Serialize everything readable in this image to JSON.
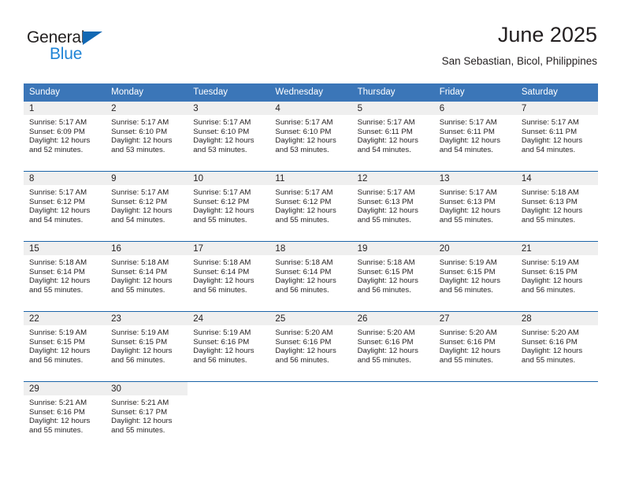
{
  "logo": {
    "primary_text": "General",
    "secondary_text": "Blue",
    "primary_color": "#221f1f",
    "accent_color": "#1268b3",
    "secondary_color": "#1f84d6"
  },
  "header": {
    "title": "June 2025",
    "subtitle": "San Sebastian, Bicol, Philippines"
  },
  "theme": {
    "header_row_bg": "#3b76b8",
    "header_row_text": "#ffffff",
    "day_number_bg": "#efefef",
    "row_divider": "#1b64a8",
    "body_text": "#231f20"
  },
  "weekdays": [
    "Sunday",
    "Monday",
    "Tuesday",
    "Wednesday",
    "Thursday",
    "Friday",
    "Saturday"
  ],
  "weeks": [
    [
      {
        "day": "1",
        "sunrise": "Sunrise: 5:17 AM",
        "sunset": "Sunset: 6:09 PM",
        "daylight_1": "Daylight: 12 hours",
        "daylight_2": "and 52 minutes."
      },
      {
        "day": "2",
        "sunrise": "Sunrise: 5:17 AM",
        "sunset": "Sunset: 6:10 PM",
        "daylight_1": "Daylight: 12 hours",
        "daylight_2": "and 53 minutes."
      },
      {
        "day": "3",
        "sunrise": "Sunrise: 5:17 AM",
        "sunset": "Sunset: 6:10 PM",
        "daylight_1": "Daylight: 12 hours",
        "daylight_2": "and 53 minutes."
      },
      {
        "day": "4",
        "sunrise": "Sunrise: 5:17 AM",
        "sunset": "Sunset: 6:10 PM",
        "daylight_1": "Daylight: 12 hours",
        "daylight_2": "and 53 minutes."
      },
      {
        "day": "5",
        "sunrise": "Sunrise: 5:17 AM",
        "sunset": "Sunset: 6:11 PM",
        "daylight_1": "Daylight: 12 hours",
        "daylight_2": "and 54 minutes."
      },
      {
        "day": "6",
        "sunrise": "Sunrise: 5:17 AM",
        "sunset": "Sunset: 6:11 PM",
        "daylight_1": "Daylight: 12 hours",
        "daylight_2": "and 54 minutes."
      },
      {
        "day": "7",
        "sunrise": "Sunrise: 5:17 AM",
        "sunset": "Sunset: 6:11 PM",
        "daylight_1": "Daylight: 12 hours",
        "daylight_2": "and 54 minutes."
      }
    ],
    [
      {
        "day": "8",
        "sunrise": "Sunrise: 5:17 AM",
        "sunset": "Sunset: 6:12 PM",
        "daylight_1": "Daylight: 12 hours",
        "daylight_2": "and 54 minutes."
      },
      {
        "day": "9",
        "sunrise": "Sunrise: 5:17 AM",
        "sunset": "Sunset: 6:12 PM",
        "daylight_1": "Daylight: 12 hours",
        "daylight_2": "and 54 minutes."
      },
      {
        "day": "10",
        "sunrise": "Sunrise: 5:17 AM",
        "sunset": "Sunset: 6:12 PM",
        "daylight_1": "Daylight: 12 hours",
        "daylight_2": "and 55 minutes."
      },
      {
        "day": "11",
        "sunrise": "Sunrise: 5:17 AM",
        "sunset": "Sunset: 6:12 PM",
        "daylight_1": "Daylight: 12 hours",
        "daylight_2": "and 55 minutes."
      },
      {
        "day": "12",
        "sunrise": "Sunrise: 5:17 AM",
        "sunset": "Sunset: 6:13 PM",
        "daylight_1": "Daylight: 12 hours",
        "daylight_2": "and 55 minutes."
      },
      {
        "day": "13",
        "sunrise": "Sunrise: 5:17 AM",
        "sunset": "Sunset: 6:13 PM",
        "daylight_1": "Daylight: 12 hours",
        "daylight_2": "and 55 minutes."
      },
      {
        "day": "14",
        "sunrise": "Sunrise: 5:18 AM",
        "sunset": "Sunset: 6:13 PM",
        "daylight_1": "Daylight: 12 hours",
        "daylight_2": "and 55 minutes."
      }
    ],
    [
      {
        "day": "15",
        "sunrise": "Sunrise: 5:18 AM",
        "sunset": "Sunset: 6:14 PM",
        "daylight_1": "Daylight: 12 hours",
        "daylight_2": "and 55 minutes."
      },
      {
        "day": "16",
        "sunrise": "Sunrise: 5:18 AM",
        "sunset": "Sunset: 6:14 PM",
        "daylight_1": "Daylight: 12 hours",
        "daylight_2": "and 55 minutes."
      },
      {
        "day": "17",
        "sunrise": "Sunrise: 5:18 AM",
        "sunset": "Sunset: 6:14 PM",
        "daylight_1": "Daylight: 12 hours",
        "daylight_2": "and 56 minutes."
      },
      {
        "day": "18",
        "sunrise": "Sunrise: 5:18 AM",
        "sunset": "Sunset: 6:14 PM",
        "daylight_1": "Daylight: 12 hours",
        "daylight_2": "and 56 minutes."
      },
      {
        "day": "19",
        "sunrise": "Sunrise: 5:18 AM",
        "sunset": "Sunset: 6:15 PM",
        "daylight_1": "Daylight: 12 hours",
        "daylight_2": "and 56 minutes."
      },
      {
        "day": "20",
        "sunrise": "Sunrise: 5:19 AM",
        "sunset": "Sunset: 6:15 PM",
        "daylight_1": "Daylight: 12 hours",
        "daylight_2": "and 56 minutes."
      },
      {
        "day": "21",
        "sunrise": "Sunrise: 5:19 AM",
        "sunset": "Sunset: 6:15 PM",
        "daylight_1": "Daylight: 12 hours",
        "daylight_2": "and 56 minutes."
      }
    ],
    [
      {
        "day": "22",
        "sunrise": "Sunrise: 5:19 AM",
        "sunset": "Sunset: 6:15 PM",
        "daylight_1": "Daylight: 12 hours",
        "daylight_2": "and 56 minutes."
      },
      {
        "day": "23",
        "sunrise": "Sunrise: 5:19 AM",
        "sunset": "Sunset: 6:15 PM",
        "daylight_1": "Daylight: 12 hours",
        "daylight_2": "and 56 minutes."
      },
      {
        "day": "24",
        "sunrise": "Sunrise: 5:19 AM",
        "sunset": "Sunset: 6:16 PM",
        "daylight_1": "Daylight: 12 hours",
        "daylight_2": "and 56 minutes."
      },
      {
        "day": "25",
        "sunrise": "Sunrise: 5:20 AM",
        "sunset": "Sunset: 6:16 PM",
        "daylight_1": "Daylight: 12 hours",
        "daylight_2": "and 56 minutes."
      },
      {
        "day": "26",
        "sunrise": "Sunrise: 5:20 AM",
        "sunset": "Sunset: 6:16 PM",
        "daylight_1": "Daylight: 12 hours",
        "daylight_2": "and 55 minutes."
      },
      {
        "day": "27",
        "sunrise": "Sunrise: 5:20 AM",
        "sunset": "Sunset: 6:16 PM",
        "daylight_1": "Daylight: 12 hours",
        "daylight_2": "and 55 minutes."
      },
      {
        "day": "28",
        "sunrise": "Sunrise: 5:20 AM",
        "sunset": "Sunset: 6:16 PM",
        "daylight_1": "Daylight: 12 hours",
        "daylight_2": "and 55 minutes."
      }
    ],
    [
      {
        "day": "29",
        "sunrise": "Sunrise: 5:21 AM",
        "sunset": "Sunset: 6:16 PM",
        "daylight_1": "Daylight: 12 hours",
        "daylight_2": "and 55 minutes."
      },
      {
        "day": "30",
        "sunrise": "Sunrise: 5:21 AM",
        "sunset": "Sunset: 6:17 PM",
        "daylight_1": "Daylight: 12 hours",
        "daylight_2": "and 55 minutes."
      },
      {
        "day": "",
        "sunrise": "",
        "sunset": "",
        "daylight_1": "",
        "daylight_2": ""
      },
      {
        "day": "",
        "sunrise": "",
        "sunset": "",
        "daylight_1": "",
        "daylight_2": ""
      },
      {
        "day": "",
        "sunrise": "",
        "sunset": "",
        "daylight_1": "",
        "daylight_2": ""
      },
      {
        "day": "",
        "sunrise": "",
        "sunset": "",
        "daylight_1": "",
        "daylight_2": ""
      },
      {
        "day": "",
        "sunrise": "",
        "sunset": "",
        "daylight_1": "",
        "daylight_2": ""
      }
    ]
  ]
}
